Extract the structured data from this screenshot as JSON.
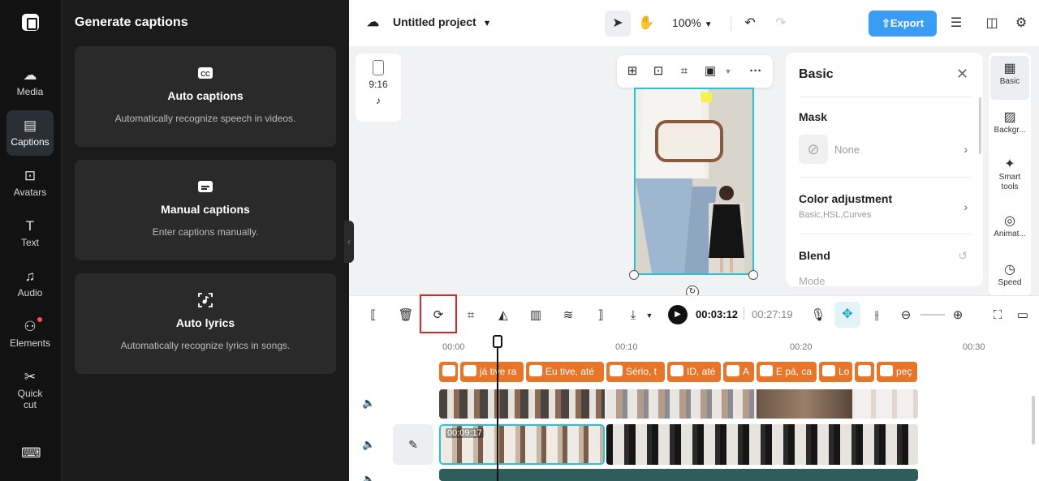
{
  "rail": {
    "items": [
      {
        "label": "Media",
        "icon": "cloud-upload-icon",
        "glyph": "☁"
      },
      {
        "label": "Captions",
        "icon": "captions-icon",
        "glyph": "▤"
      },
      {
        "label": "Avatars",
        "icon": "avatar-icon",
        "glyph": "⊡"
      },
      {
        "label": "Text",
        "icon": "text-icon",
        "glyph": "T"
      },
      {
        "label": "Audio",
        "icon": "music-note-icon",
        "glyph": "♫"
      },
      {
        "label": "Elements",
        "icon": "elements-icon",
        "glyph": "⚇"
      },
      {
        "label": "Quick cut",
        "icon": "quick-cut-icon",
        "glyph": "✂"
      }
    ],
    "keyboard_icon": "⌨"
  },
  "panel": {
    "title": "Generate captions",
    "cards": [
      {
        "title": "Auto captions",
        "desc": "Automatically recognize speech in videos."
      },
      {
        "title": "Manual captions",
        "desc": "Enter captions manually."
      },
      {
        "title": "Auto lyrics",
        "desc": "Automatically recognize lyrics in songs."
      }
    ]
  },
  "topbar": {
    "project_name": "Untitled project",
    "zoom": "100%",
    "export_label": "Export"
  },
  "ratio": {
    "label": "9:16"
  },
  "props": {
    "title": "Basic",
    "mask_label": "Mask",
    "mask_value": "None",
    "color_label": "Color adjustment",
    "color_sub": "Basic,HSL,Curves",
    "blend_label": "Blend",
    "mode_label": "Mode"
  },
  "side_tabs": [
    {
      "label": "Basic",
      "glyph": "▦"
    },
    {
      "label": "Backgr...",
      "glyph": "▨"
    },
    {
      "label": "Smart tools",
      "glyph": "✦"
    },
    {
      "label": "Animat...",
      "glyph": "◎"
    },
    {
      "label": "Speed",
      "glyph": "◷"
    }
  ],
  "timeline": {
    "current_time": "00:03:12",
    "total_time": "00:27:19",
    "ticks": [
      "00:00",
      "00:10",
      "00:20",
      "00:30"
    ],
    "caption_clips": [
      "",
      "já tive ra",
      "Eu tive, até",
      "Sério, t",
      "ID, até",
      "A",
      "E pá, ca",
      "Lo",
      "",
      "peç"
    ],
    "main_clip_time": "00:09:17"
  },
  "colors": {
    "accent": "#3b9cf6",
    "selection": "#27c2d6",
    "caption_clip": "#e8762a",
    "highlight": "#e02424"
  }
}
